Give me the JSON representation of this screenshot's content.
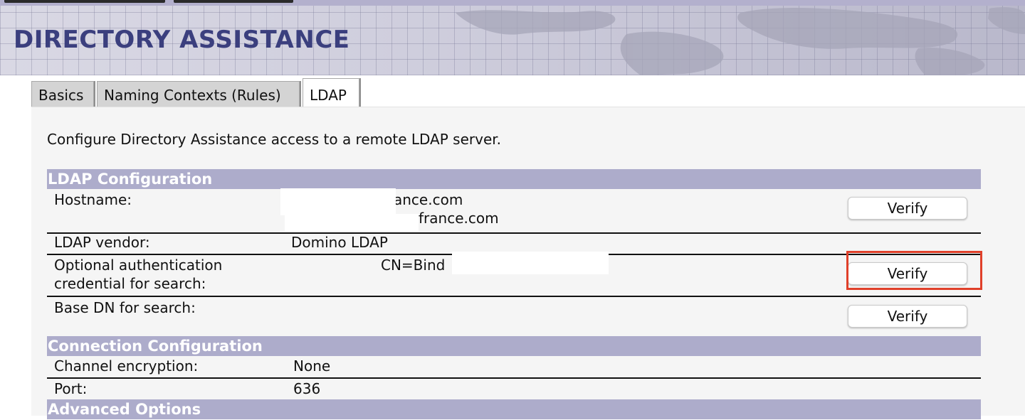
{
  "header": {
    "title": "DIRECTORY ASSISTANCE"
  },
  "tabs": [
    {
      "label": "Basics",
      "active": false
    },
    {
      "label": "Naming Contexts (Rules)",
      "active": false
    },
    {
      "label": "LDAP",
      "active": true
    }
  ],
  "intro_text": "Configure Directory Assistance access to a remote LDAP server.",
  "ldap_config": {
    "section_title": "LDAP Configuration",
    "hostname": {
      "label": "Hostname:",
      "value_line1": "ance.com",
      "value_line2": "france.com",
      "verify_label": "Verify"
    },
    "vendor": {
      "label": "LDAP vendor:",
      "value": "Domino LDAP"
    },
    "auth_credential": {
      "label_line1": "Optional authentication",
      "label_line2": "credential for search:",
      "value": "CN=Bind",
      "verify_label": "Verify"
    },
    "base_dn": {
      "label": "Base DN for search:",
      "verify_label": "Verify"
    }
  },
  "connection_config": {
    "section_title": "Connection Configuration",
    "channel_encryption": {
      "label": "Channel encryption:",
      "value": "None"
    },
    "port": {
      "label": "Port:",
      "value": "636"
    }
  },
  "advanced_options": {
    "section_title": "Advanced Options"
  },
  "colors": {
    "header_title": "#3b3f7e",
    "section_bg": "#adaccb",
    "highlight": "#e0402a"
  }
}
